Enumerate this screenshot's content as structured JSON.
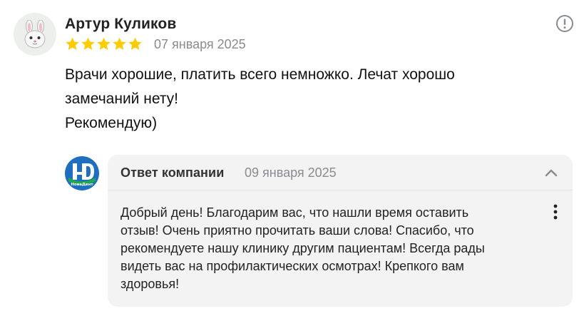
{
  "review": {
    "author": "Артур Куликов",
    "rating": 5,
    "date": "07 января 2025",
    "text": "Врачи хорошие, платить всего немножко. Лечат хорошо\nзамечаний нету!\nРекомендую)",
    "icons": {
      "avatar": "bunny-emoji-avatar",
      "info": "info-circle-icon",
      "star": "star-icon"
    },
    "colors": {
      "star": "#ffcc00",
      "date": "#888b90"
    }
  },
  "reply": {
    "title": "Ответ компании",
    "date": "09 января 2025",
    "text": "Добрый день! Благодарим вас, что нашли время оставить\nотзыв! Очень приятно прочитать ваши слова! Спасибо, что\nрекомендуете нашу клинику другим пациентам! Всегда рады\nвидеть вас на профилактических осмотрах! Крепкого вам\nздоровья!",
    "logo_text": "НоваДент",
    "icons": {
      "logo": "company-logo",
      "collapse": "chevron-up-icon",
      "more": "more-vertical-icon"
    },
    "colors": {
      "background": "#f3f3f3",
      "logo_blue": "#1e6fc0",
      "logo_green": "#1faa4a"
    }
  }
}
